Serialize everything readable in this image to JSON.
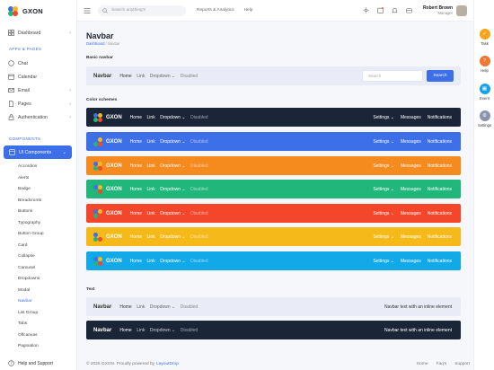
{
  "brand": {
    "name": "GXON"
  },
  "sidebar": {
    "top_items": [
      {
        "label": "Dashboard",
        "icon": "grid-icon",
        "chevron": "›"
      }
    ],
    "section_apps": "APPS & PAGES",
    "app_items": [
      {
        "label": "Chat",
        "icon": "chat-icon",
        "chevron": ""
      },
      {
        "label": "Calendar",
        "icon": "calendar-icon",
        "chevron": ""
      },
      {
        "label": "Email",
        "icon": "mail-icon",
        "chevron": "›"
      },
      {
        "label": "Pages",
        "icon": "file-icon",
        "chevron": "›"
      },
      {
        "label": "Authentication",
        "icon": "lock-icon",
        "chevron": "›"
      }
    ],
    "section_components": "COMPONENTS",
    "active_item": {
      "label": "UI Components",
      "chevron": "⌄"
    },
    "sub_items": [
      "Accordion",
      "Alerts",
      "Badge",
      "Breadcrumb",
      "Buttons",
      "Typography",
      "Button Group",
      "Card",
      "Collapse",
      "Carousel",
      "Dropdowns",
      "Modal",
      "Navbar",
      "List Group",
      "Tabs",
      "Offcanvas",
      "Pagination"
    ],
    "active_sub": "Navbar",
    "help": "Help and Support"
  },
  "topbar": {
    "search_placeholder": "Search anything's",
    "links": [
      "Reports & Analytics",
      "Help"
    ],
    "user_name": "Robert Brown",
    "user_role": "Manager"
  },
  "rail": [
    {
      "label": "Task",
      "color": "#f7a41d",
      "glyph": "✓"
    },
    {
      "label": "Help",
      "color": "#f2762e",
      "glyph": "?"
    },
    {
      "label": "Event",
      "color": "#17a2e8",
      "glyph": "▦"
    },
    {
      "label": "Settings",
      "color": "#8a93b0",
      "glyph": "⚙"
    }
  ],
  "page": {
    "title": "Navbar",
    "breadcrumb": [
      "Dashboard",
      "/",
      "Navbar"
    ]
  },
  "sections": {
    "basic": "Basic navbar",
    "colors": "Color schemes",
    "text": "Text"
  },
  "basic_navbar": {
    "brand": "Navbar",
    "links": [
      "Home",
      "Link",
      "Dropdown ⌄",
      "Disabled"
    ],
    "search_placeholder": "Search",
    "search_button": "Search"
  },
  "scheme_navbar": {
    "brand": "GXON",
    "links": [
      "Home",
      "Link",
      "Dropdown ⌄",
      "Disabled"
    ],
    "right_links": [
      "Settings ⌄",
      "Messages",
      "Notifications"
    ]
  },
  "color_schemes": [
    "#1a2538",
    "#3d6fe8",
    "#f58a1f",
    "#22b77a",
    "#f4462b",
    "#f6b91a",
    "#11a9e8"
  ],
  "text_navbars": [
    {
      "brand": "Navbar",
      "links": [
        "Home",
        "Link",
        "Dropdown ⌄",
        "Disabled"
      ],
      "text": "Navbar text with an inline element",
      "bg": "#e9ecf6"
    },
    {
      "brand": "Navbar",
      "links": [
        "Home",
        "Link",
        "Dropdown ⌄",
        "Disabled"
      ],
      "text": "Navbar text with an inline element",
      "bg": "#1a2538"
    }
  ],
  "footer": {
    "copy": "© 2025 GXON. Proudly powered by",
    "powered": "LayoutDrop",
    "links": [
      "Home",
      "Faq's",
      "Support"
    ]
  }
}
